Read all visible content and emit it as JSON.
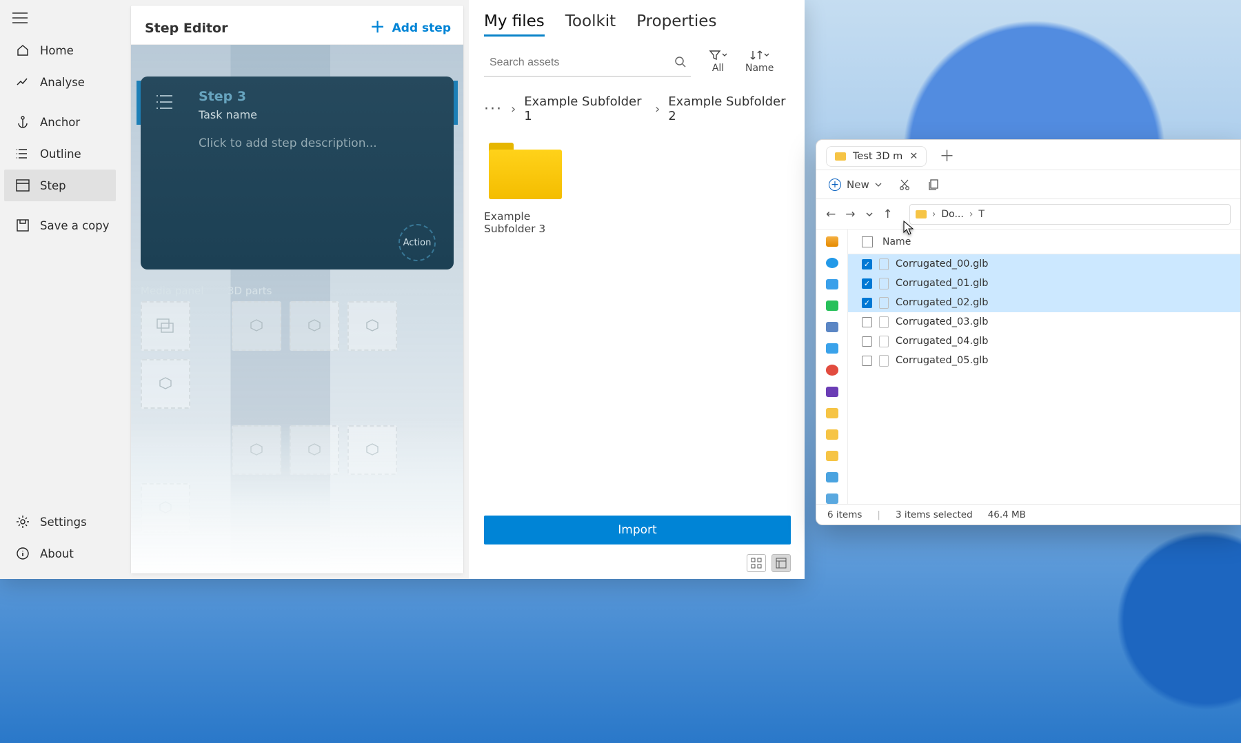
{
  "sidebar": {
    "items": [
      {
        "label": "Home"
      },
      {
        "label": "Analyse"
      },
      {
        "label": "Anchor"
      },
      {
        "label": "Outline"
      },
      {
        "label": "Step"
      },
      {
        "label": "Save a copy"
      }
    ],
    "footer": [
      {
        "label": "Settings"
      },
      {
        "label": "About"
      }
    ]
  },
  "editor": {
    "title": "Step Editor",
    "add_step": "Add step",
    "step": {
      "title": "Step 3",
      "task": "Task name",
      "desc": "Click to add step description..."
    },
    "action_label": "Action",
    "panels": {
      "media": "Media panel",
      "parts": "3D parts"
    }
  },
  "assets": {
    "tabs": [
      "My files",
      "Toolkit",
      "Properties"
    ],
    "active_tab": 0,
    "search_placeholder": "Search assets",
    "filter": {
      "label": "All"
    },
    "sort": {
      "label": "Name"
    },
    "breadcrumb": [
      "Example Subfolder 1",
      "Example Subfolder 2"
    ],
    "folders": [
      {
        "name": "Example Subfolder 3"
      }
    ],
    "import": "Import"
  },
  "explorer": {
    "tab_title": "Test 3D m",
    "new_label": "New",
    "path_segment": "Do...",
    "name_header": "Name",
    "files": [
      {
        "name": "Corrugated_00.glb",
        "selected": true
      },
      {
        "name": "Corrugated_01.glb",
        "selected": true
      },
      {
        "name": "Corrugated_02.glb",
        "selected": true
      },
      {
        "name": "Corrugated_03.glb",
        "selected": false
      },
      {
        "name": "Corrugated_04.glb",
        "selected": false
      },
      {
        "name": "Corrugated_05.glb",
        "selected": false
      }
    ],
    "status": {
      "count": "6 items",
      "selected": "3 items selected",
      "size": "46.4 MB"
    }
  }
}
